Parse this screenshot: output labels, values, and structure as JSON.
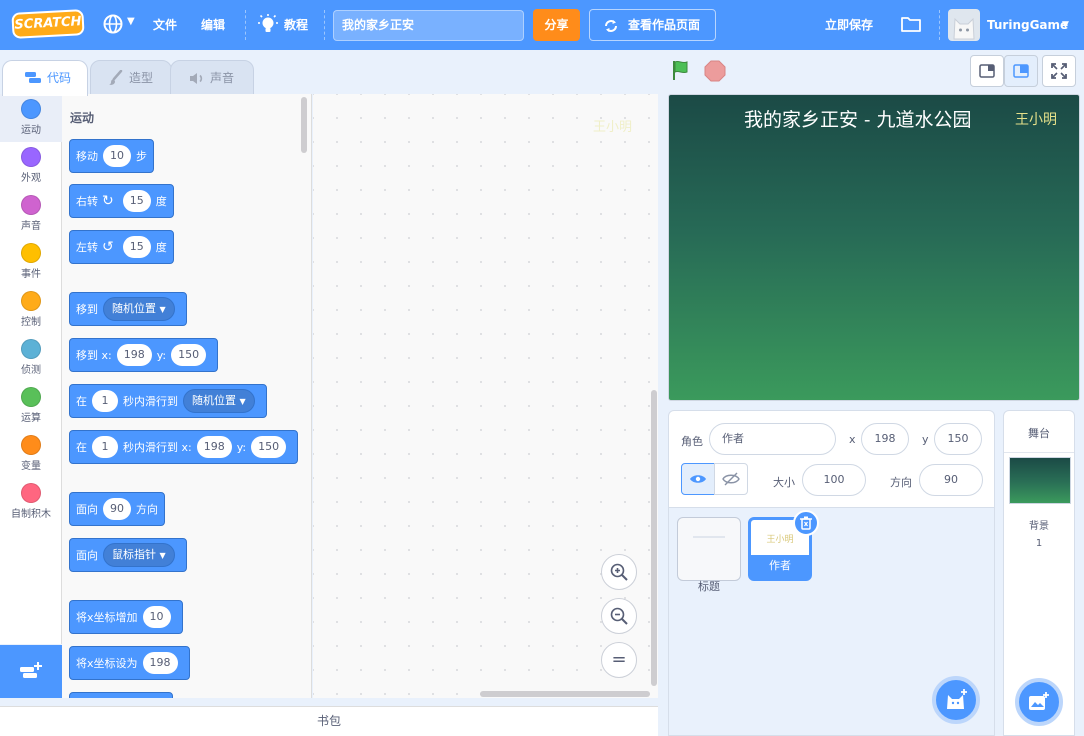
{
  "menu": {
    "logo": "SCRATCH",
    "file": "文件",
    "edit": "编辑",
    "tutorials": "教程",
    "project_title": "我的家乡正安",
    "share": "分享",
    "see_project_page": "查看作品页面",
    "save_now": "立即保存",
    "username": "TuringGame"
  },
  "tabs": {
    "code": "代码",
    "costumes": "造型",
    "sounds": "声音"
  },
  "categories": [
    {
      "label": "运动",
      "color": "#4c97ff"
    },
    {
      "label": "外观",
      "color": "#9966ff"
    },
    {
      "label": "声音",
      "color": "#cf63cf"
    },
    {
      "label": "事件",
      "color": "#ffbf00"
    },
    {
      "label": "控制",
      "color": "#ffab19"
    },
    {
      "label": "侦测",
      "color": "#5cb1d6"
    },
    {
      "label": "运算",
      "color": "#59c059"
    },
    {
      "label": "变量",
      "color": "#ff8c1a"
    },
    {
      "label": "自制积木",
      "color": "#ff6680"
    }
  ],
  "palette": {
    "section_title": "运动",
    "blocks": {
      "move": {
        "a": "移动",
        "v": "10",
        "b": "步"
      },
      "turn_right": {
        "a": "右转",
        "v": "15",
        "b": "度"
      },
      "turn_left": {
        "a": "左转",
        "v": "15",
        "b": "度"
      },
      "goto": {
        "a": "移到",
        "dd": "随机位置"
      },
      "goto_xy": {
        "a": "移到 x:",
        "x": "198",
        "yl": "y:",
        "y": "150"
      },
      "glide": {
        "a": "在",
        "v": "1",
        "b": "秒内滑行到",
        "dd": "随机位置"
      },
      "glide_xy": {
        "a": "在",
        "v": "1",
        "b": "秒内滑行到 x:",
        "x": "198",
        "yl": "y:",
        "y": "150"
      },
      "point_dir": {
        "a": "面向",
        "v": "90",
        "b": "方向"
      },
      "point_towards": {
        "a": "面向",
        "dd": "鼠标指针"
      },
      "change_x": {
        "a": "将x坐标增加",
        "v": "10"
      },
      "set_x": {
        "a": "将x坐标设为",
        "v": "198"
      }
    }
  },
  "code_area": {
    "ghost_text": "王小明"
  },
  "backpack": "书包",
  "stage": {
    "title": "我的家乡正安 - 九道水公园",
    "author": "王小明"
  },
  "sprite_info": {
    "sprite_label": "角色",
    "sprite_name": "作者",
    "x_label": "x",
    "x": "198",
    "y_label": "y",
    "y": "150",
    "size_label": "大小",
    "size": "100",
    "direction_label": "方向",
    "direction": "90"
  },
  "sprites": [
    {
      "name": "标题",
      "thumb": ""
    },
    {
      "name": "作者",
      "thumb": "王小明"
    }
  ],
  "stage_pane": {
    "header": "舞台",
    "backdrops_label": "背景",
    "backdrops_count": "1"
  }
}
